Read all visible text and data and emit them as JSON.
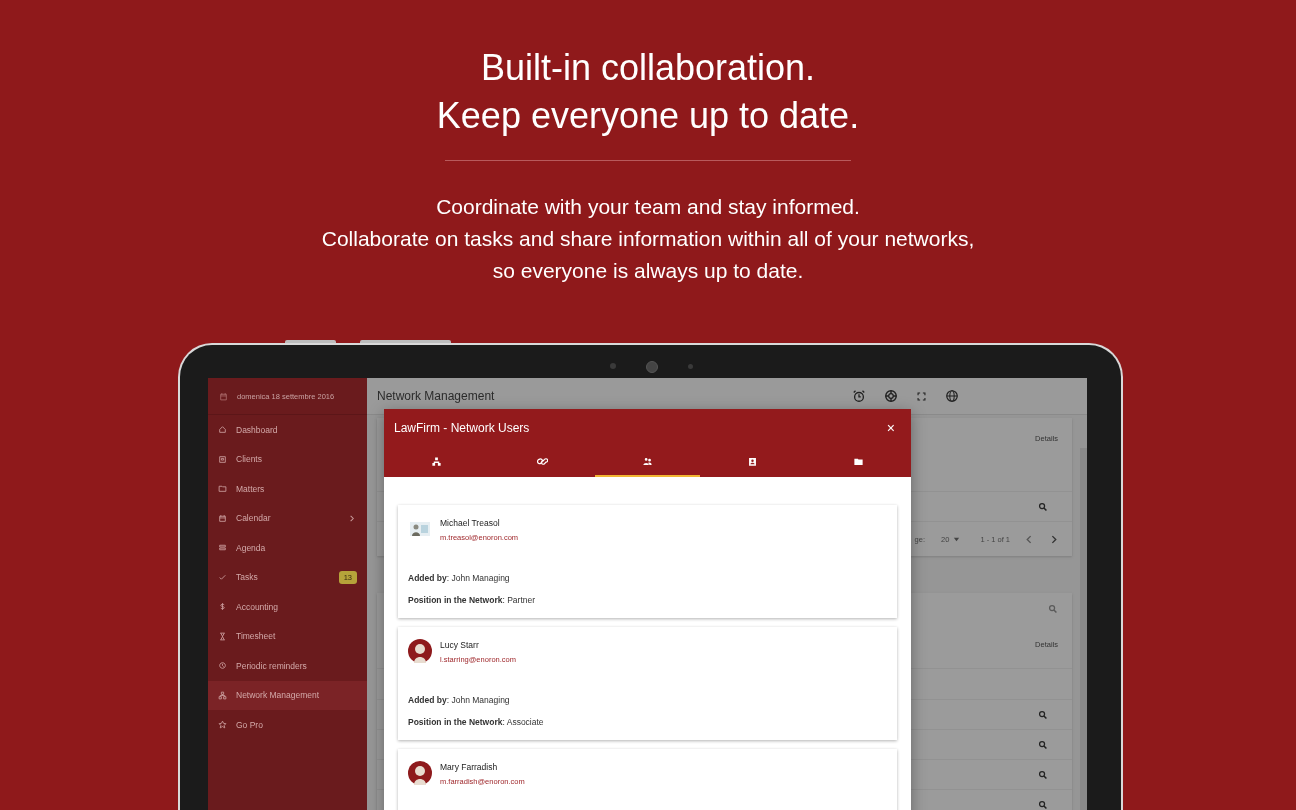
{
  "hero": {
    "title_lines": [
      "Built-in collaboration.",
      "Keep everyone up to date."
    ],
    "subtitle_lines": [
      "Coordinate with your team and stay informed.",
      "Collaborate on tasks and share information within all of your networks,",
      "so everyone is always up to date."
    ]
  },
  "sidebar": {
    "date": "domenica 18 settembre 2016",
    "items": [
      {
        "label": "Dashboard",
        "selected": false
      },
      {
        "label": "Clients",
        "selected": false
      },
      {
        "label": "Matters",
        "selected": false
      },
      {
        "label": "Calendar",
        "selected": false,
        "expandable": true
      },
      {
        "label": "Agenda",
        "selected": false
      },
      {
        "label": "Tasks",
        "selected": false,
        "badge": "13"
      },
      {
        "label": "Accounting",
        "selected": false
      },
      {
        "label": "Timesheet",
        "selected": false
      },
      {
        "label": "Periodic reminders",
        "selected": false
      },
      {
        "label": "Network Management",
        "selected": true
      },
      {
        "label": "Go Pro",
        "selected": false
      }
    ]
  },
  "topbar": {
    "title": "Network Management"
  },
  "background": {
    "cards": [
      {
        "header": "Details",
        "pagination": {
          "rows_label": "ge:",
          "rows_per_page": "20",
          "range": "1 - 1 of 1"
        }
      },
      {
        "header": "Details",
        "search": true
      }
    ]
  },
  "dialog": {
    "title": "LawFirm - Network Users",
    "close": "×",
    "tabs": [
      {
        "selected": false
      },
      {
        "selected": false
      },
      {
        "selected": true
      },
      {
        "selected": false
      },
      {
        "selected": false
      }
    ],
    "users": [
      {
        "name": "Michael Treasol",
        "email": "m.treasol@enoron.com",
        "kind": "photo",
        "added_by": "**Added by**: John Managing",
        "position": "**Position in the Network**: Partner"
      },
      {
        "name": "Lucy Starr",
        "email": "l.starring@enoron.com",
        "kind": "portrait",
        "added_by": "**Added by**: John Managing",
        "position": "**Position in the Network**: Associate"
      },
      {
        "name": "Mary Farradish",
        "email": "m.farradish@enoron.com",
        "kind": "portrait"
      }
    ]
  }
}
